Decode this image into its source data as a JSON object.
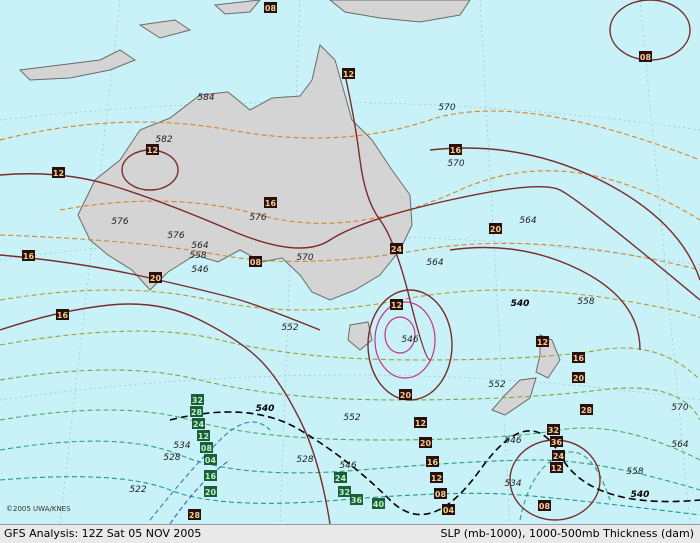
{
  "footer": {
    "left": "GFS Analysis: 12Z Sat 05 NOV 2005",
    "right": "SLP (mb-1000), 1000-500mb Thickness (dam)"
  },
  "credit": "©2005 UWA/KNES",
  "colors": {
    "ocean": "#c8f2f7",
    "land": "#d4d4d4",
    "isobar": "#7a2c2c",
    "thickness_warm": "#d9822b",
    "thickness_cold": "#1f9a6b",
    "thickness_mid": "#8a8a3a"
  },
  "isobar_labels": [
    "08",
    "08",
    "12",
    "16",
    "12",
    "12",
    "20",
    "16",
    "08",
    "20",
    "16",
    "24",
    "12",
    "16",
    "20",
    "12",
    "20",
    "16",
    "12",
    "08",
    "04",
    "12",
    "16",
    "20",
    "28",
    "32",
    "36",
    "24",
    "12",
    "08",
    "32",
    "28",
    "24",
    "12",
    "08",
    "04",
    "16",
    "20",
    "24",
    "32",
    "36",
    "40",
    "28",
    "24",
    "20",
    "16"
  ],
  "thickness_labels": [
    "584",
    "582",
    "570",
    "576",
    "576",
    "564",
    "558",
    "546",
    "570",
    "570",
    "564",
    "558",
    "552",
    "546",
    "576",
    "564",
    "540",
    "552",
    "534",
    "528",
    "522",
    "540",
    "528",
    "546",
    "552",
    "570",
    "564",
    "558",
    "546",
    "540",
    "534"
  ]
}
